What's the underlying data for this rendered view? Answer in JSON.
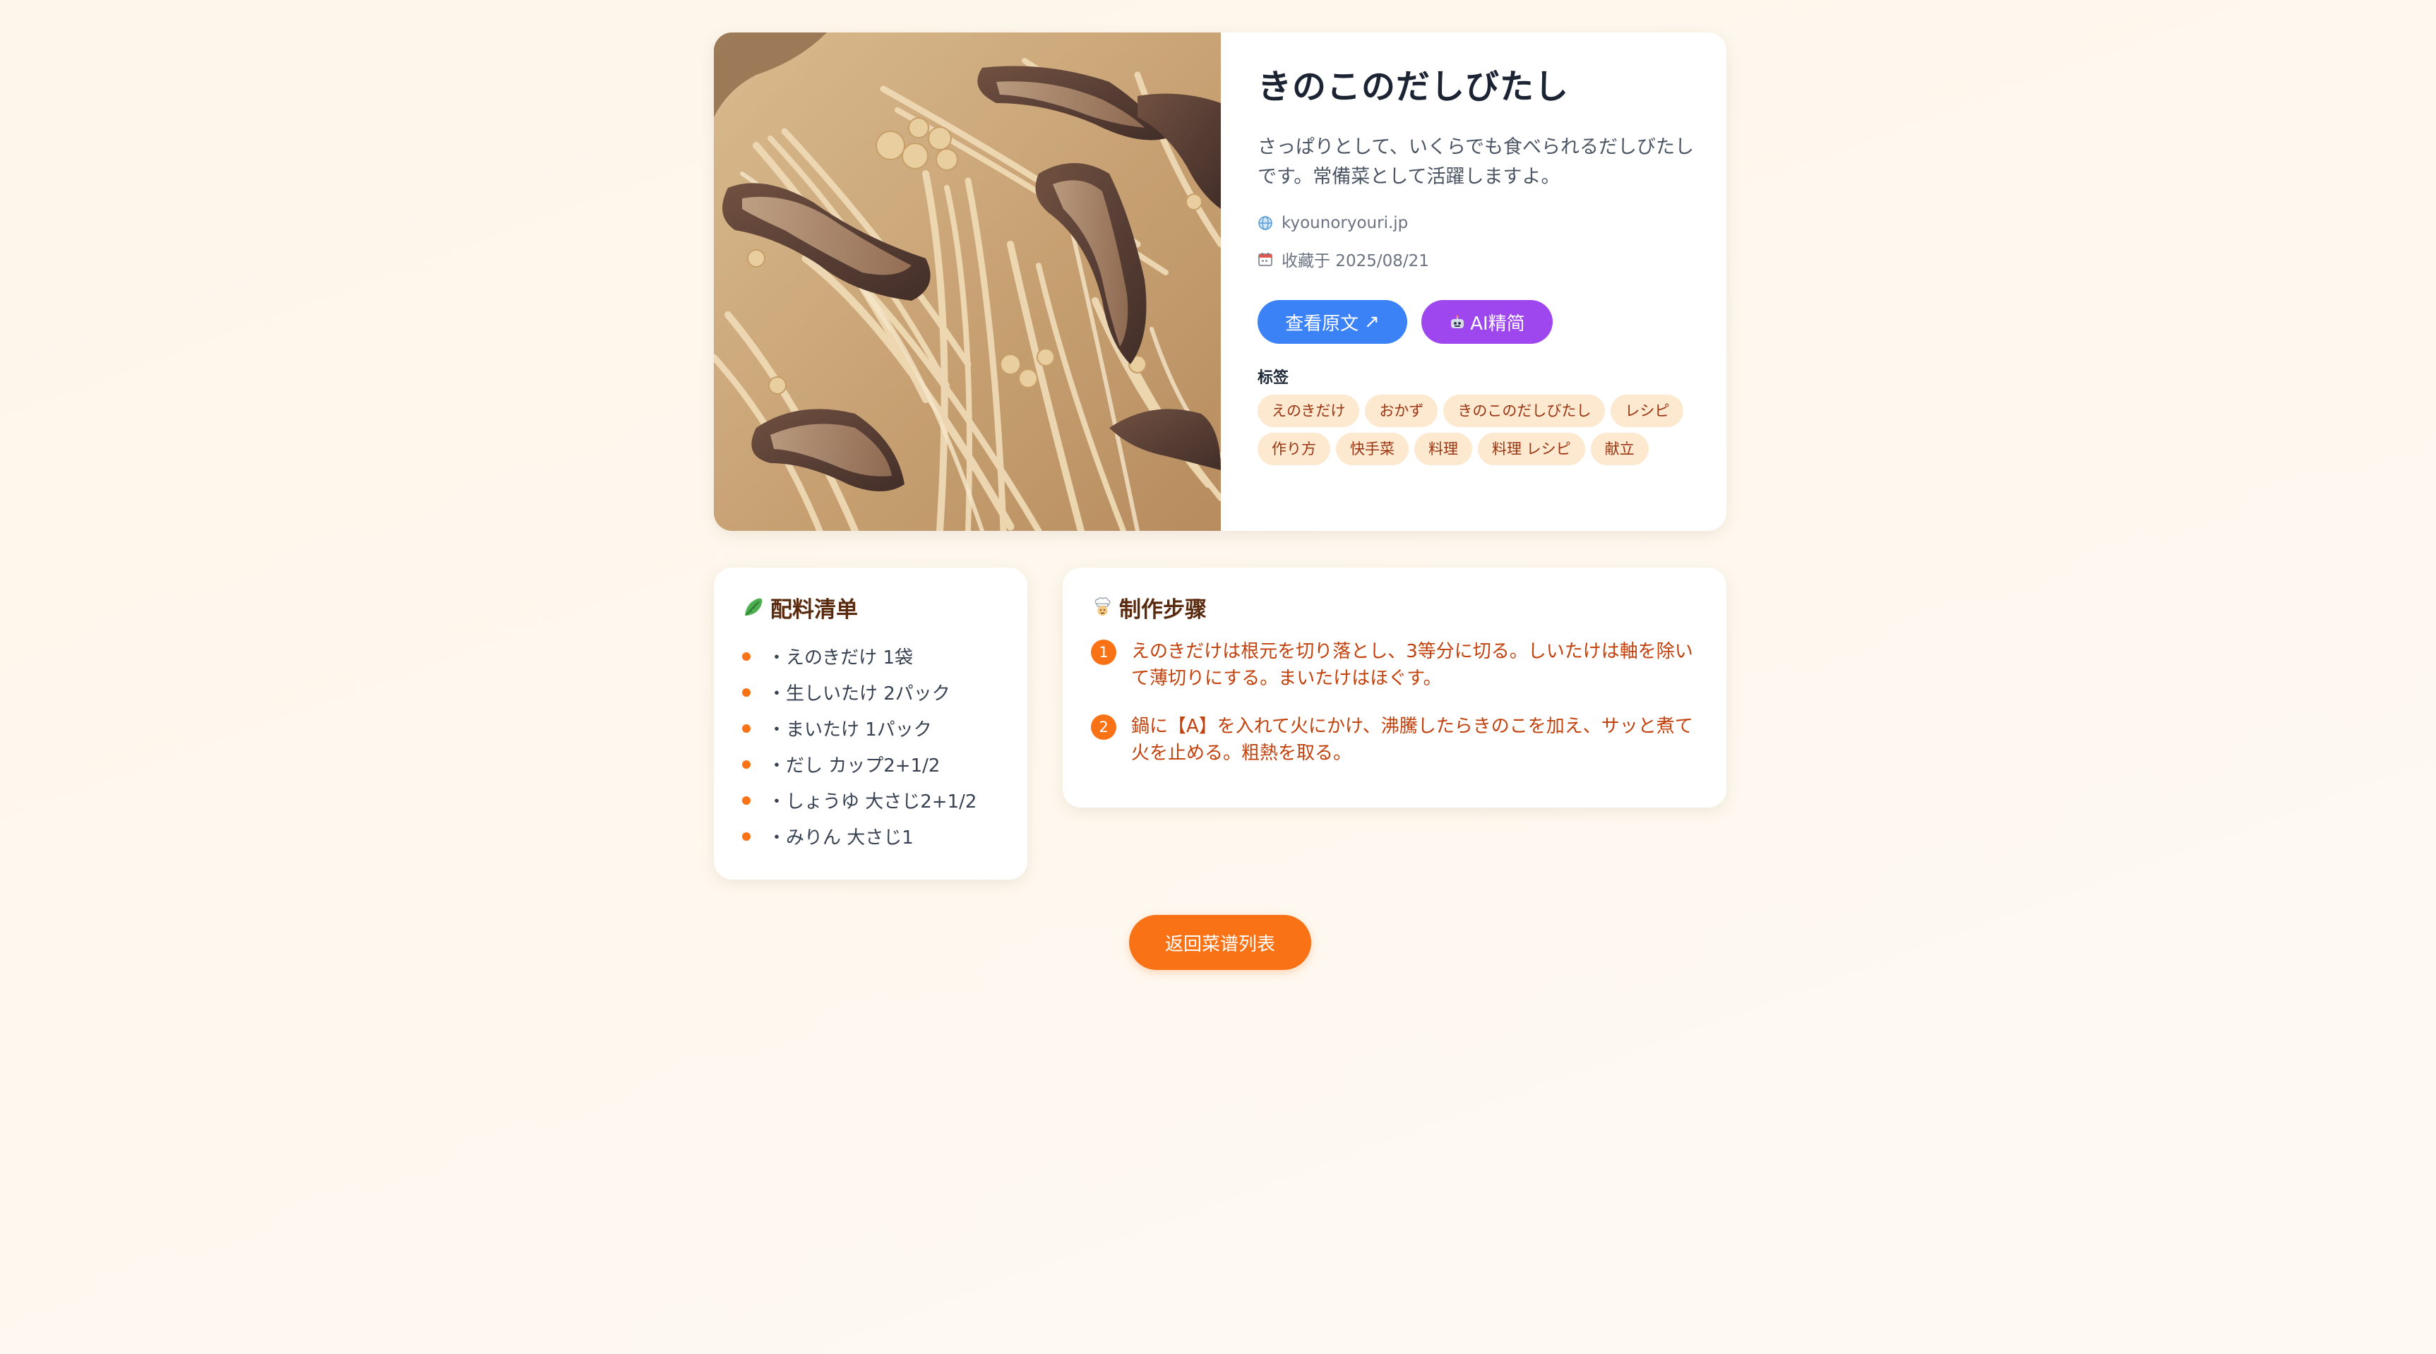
{
  "recipe": {
    "title": "きのこのだしびたし",
    "description": "さっぱりとして、いくらでも食べられるだしびたしです。常備菜として活躍しますよ。",
    "source": "kyounoryouri.jp",
    "saved_date": "收藏于 2025/08/21",
    "source_icon": "globe-icon",
    "date_icon": "calendar-icon"
  },
  "actions": {
    "view_original": "查看原文",
    "view_original_glyph": "↗",
    "ai_simplify": "AI精简",
    "ai_icon": "robot-icon"
  },
  "tags": {
    "label": "标签",
    "items": [
      "えのきだけ",
      "おかず",
      "きのこのだしびたし",
      "レシピ",
      "作り方",
      "快手菜",
      "料理",
      "料理 レシピ",
      "献立"
    ]
  },
  "ingredients": {
    "title": "配料清单",
    "icon": "leafy-green-icon",
    "items": [
      "・えのきだけ 1袋",
      "・生しいたけ 2パック",
      "・まいたけ 1パック",
      "・だし カップ2+1/2",
      "・しょうゆ 大さじ2+1/2",
      "・みりん 大さじ1"
    ]
  },
  "steps": {
    "title": "制作步骤",
    "icon": "chef-icon",
    "items": [
      {
        "num": "1",
        "text": "えのきだけは根元を切り落とし、3等分に切る。しいたけは軸を除いて薄切りにする。まいたけはほぐす。"
      },
      {
        "num": "2",
        "text": "鍋に【A】を入れて火にかけ、沸騰したらきのこを加え、サッと煮て火を止める。粗熱を取る。"
      }
    ]
  },
  "footer": {
    "back_label": "返回菜谱列表"
  },
  "colors": {
    "accent": "#f97316",
    "primary_button": "#3b82f6",
    "ai_button": "#9f47ee",
    "tag_bg": "#fde9cf",
    "step_text": "#c2410c"
  }
}
